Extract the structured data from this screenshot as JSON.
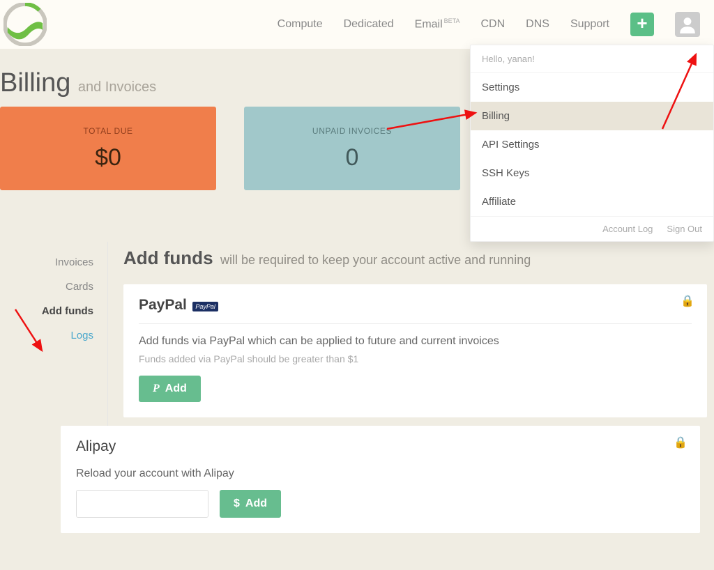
{
  "header": {
    "nav": {
      "compute": "Compute",
      "dedicated": "Dedicated",
      "email": "Email",
      "email_badge": "BETA",
      "cdn": "CDN",
      "dns": "DNS",
      "support": "Support"
    }
  },
  "dropdown": {
    "greeting": "Hello, yanan!",
    "items": {
      "settings": "Settings",
      "billing": "Billing",
      "api": "API Settings",
      "ssh": "SSH Keys",
      "affiliate": "Affiliate"
    },
    "footer": {
      "log": "Account Log",
      "signout": "Sign Out"
    }
  },
  "title": {
    "main": "Billing",
    "sub": "and Invoices"
  },
  "cards": {
    "total_due": {
      "label": "TOTAL DUE",
      "value": "$0"
    },
    "unpaid": {
      "label": "UNPAID INVOICES",
      "value": "0"
    }
  },
  "sidebar": {
    "invoices": "Invoices",
    "cards": "Cards",
    "addfunds": "Add funds",
    "logs": "Logs"
  },
  "main": {
    "heading": "Add funds",
    "sub": "will be required to keep your account active and running"
  },
  "paypal": {
    "title": "PayPal",
    "badge": "PayPal",
    "desc": "Add funds via PayPal which can be applied to future and current invoices",
    "note": "Funds added via PayPal should be greater than $1",
    "button": "Add"
  },
  "alipay": {
    "title": "Alipay",
    "desc": "Reload your account with Alipay",
    "currency": "$",
    "button": "Add"
  }
}
